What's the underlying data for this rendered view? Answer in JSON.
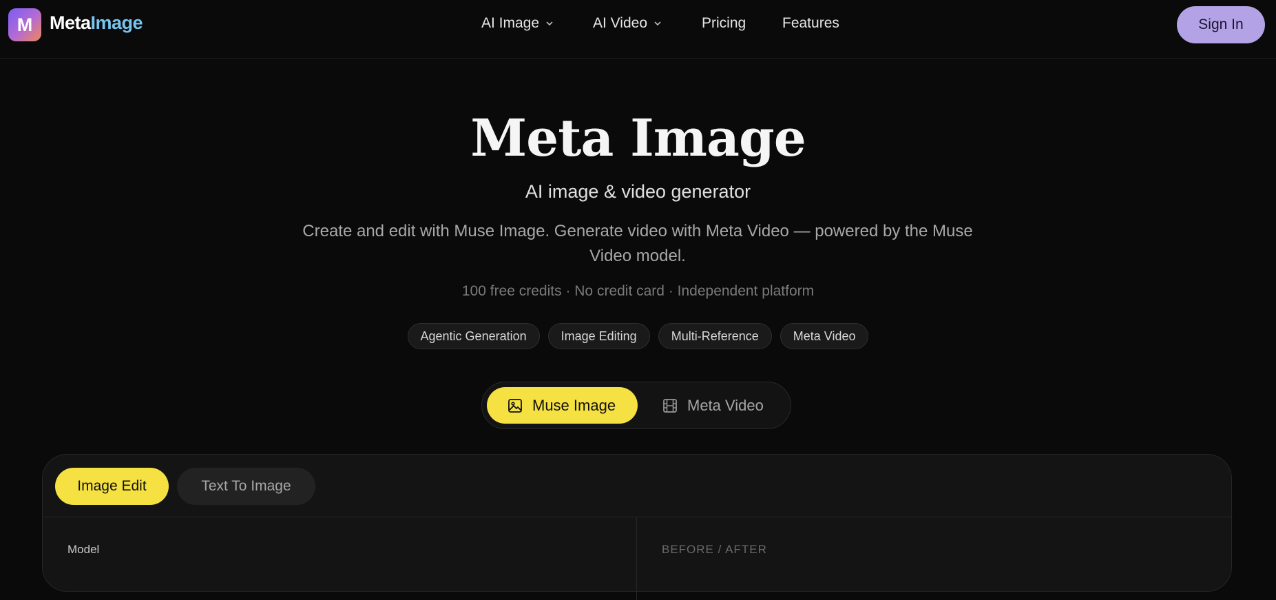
{
  "brand": {
    "logo_letter": "M",
    "name_part1": "Meta",
    "name_part2": "Image",
    "accent": "#78c4f0"
  },
  "nav": {
    "items": [
      {
        "label": "AI Image",
        "has_dropdown": true
      },
      {
        "label": "AI Video",
        "has_dropdown": true
      },
      {
        "label": "Pricing",
        "has_dropdown": false
      },
      {
        "label": "Features",
        "has_dropdown": false
      }
    ],
    "sign_in": "Sign In"
  },
  "hero": {
    "title": "Meta Image",
    "subtitle": "AI image & video generator",
    "description": "Create and edit with Muse Image. Generate video with Meta Video — powered by the Muse Video model.",
    "meta": "100 free credits · No credit card · Independent platform",
    "pills": [
      "Agentic Generation",
      "Image Editing",
      "Multi-Reference",
      "Meta Video"
    ]
  },
  "mode_switch": {
    "active": {
      "label": "Muse Image",
      "icon": "image-icon"
    },
    "inactive": {
      "label": "Meta Video",
      "icon": "film-icon"
    },
    "active_color": "#f5e142"
  },
  "panel": {
    "tabs": [
      {
        "label": "Image Edit",
        "active": true
      },
      {
        "label": "Text To Image",
        "active": false
      }
    ],
    "left_label": "Model",
    "right_label": "BEFORE / AFTER"
  }
}
